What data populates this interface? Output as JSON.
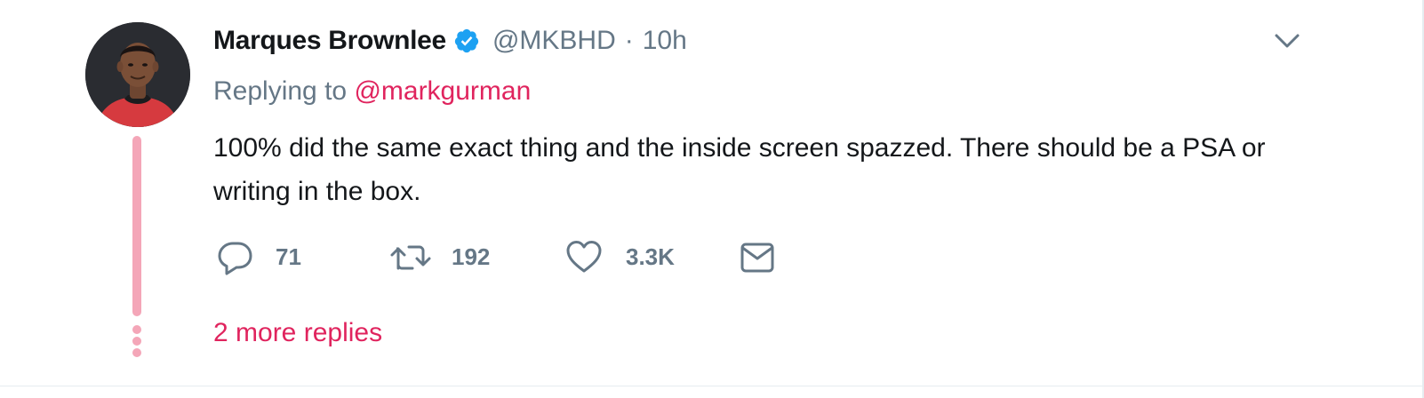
{
  "tweet": {
    "author": {
      "display_name": "Marques Brownlee",
      "handle": "@MKBHD",
      "verified": true,
      "avatar_icon": "profile-photo"
    },
    "separator": "·",
    "time": "10h",
    "replying_prefix": "Replying to ",
    "replying_to": "@markgurman",
    "text": "100% did the same exact thing and the inside screen spazzed. There should be a PSA or writing in the box.",
    "actions": {
      "reply_count": "71",
      "retweet_count": "192",
      "like_count": "3.3K"
    },
    "more_replies": "2 more replies"
  },
  "colors": {
    "text_primary": "#14171a",
    "text_secondary": "#657786",
    "accent_pink": "#e0245e",
    "thread_line": "#f4a6b8",
    "verified_blue": "#1da1f2"
  },
  "icons": {
    "verified": "verified-badge-icon",
    "caret": "chevron-down-icon",
    "reply": "reply-bubble-icon",
    "retweet": "retweet-icon",
    "like": "heart-icon",
    "message": "envelope-icon"
  }
}
